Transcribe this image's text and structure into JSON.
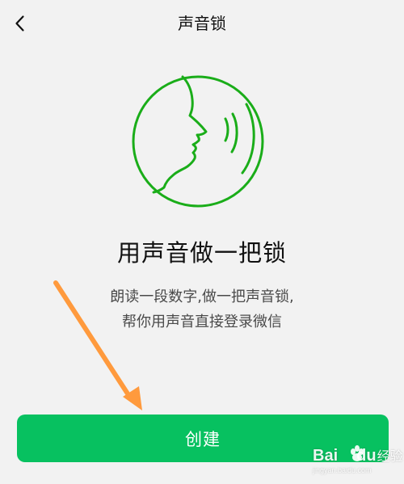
{
  "header": {
    "back_icon": "chevron-left-icon",
    "title": "声音锁"
  },
  "hero": {
    "icon": "voice-face-icon",
    "accent_color": "#1aad19"
  },
  "content": {
    "headline": "用声音做一把锁",
    "description_lines": [
      "朗读一段数字,做一把声音锁,",
      "帮你用声音直接登录微信"
    ]
  },
  "actions": {
    "create_label": "创建",
    "button_color": "#07c160"
  },
  "annotation": {
    "arrow_color": "#ff9a3d"
  },
  "watermark": {
    "brand": "Bai",
    "brand_suffix": "du",
    "brand_cn": "经验",
    "url": "jingyan.baidu.com"
  }
}
